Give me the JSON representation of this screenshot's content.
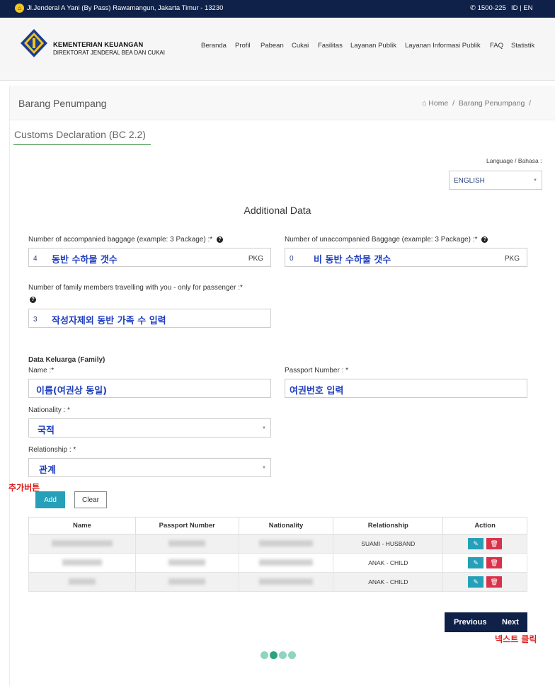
{
  "topbar": {
    "address": "Jl.Jenderal A Yani (By Pass) Rawamangun, Jakarta Timur - 13230",
    "phone": "1500-225",
    "lang": "ID | EN"
  },
  "brand": {
    "line1": "KEMENTERIAN KEUANGAN",
    "line2": "DIREKTORAT JENDERAL BEA DAN CUKAI"
  },
  "nav": [
    "Beranda",
    "Profil",
    "Pabean",
    "Cukai",
    "Fasilitas",
    "Layanan Publik",
    "Layanan Informasi Publik",
    "FAQ",
    "Statistik"
  ],
  "page": {
    "title": "Barang Penumpang",
    "breadcrumb_home": "Home",
    "breadcrumb_current": "Barang Penumpang"
  },
  "section_title": "Customs Declaration (BC 2.2)",
  "language": {
    "label": "Language / Bahasa :",
    "selected": "ENGLISH"
  },
  "subhead": "Additional Data",
  "baggage": {
    "accompanied_label": "Number of accompanied baggage (example: 3 Package) :*",
    "accompanied_value": "4",
    "accompanied_note": "동반 수하물 갯수",
    "unaccompanied_label": "Number of unaccompanied Baggage (example: 3 Package) :*",
    "unaccompanied_value": "0",
    "unaccompanied_note": "비 동반 수하물 갯수",
    "unit": "PKG",
    "family_count_label": "Number of family members travelling with you - only for passenger :*",
    "family_count_value": "3",
    "family_count_note": "작성자제외 동반 가족 수 입력"
  },
  "family_form": {
    "heading": "Data Keluarga (Family)",
    "name_label": "Name :*",
    "name_note": "이름(여권상 동일)",
    "passport_label": "Passport Number : *",
    "passport_note": "여권번호 입력",
    "nationality_label": "Nationality : *",
    "nationality_note": "국적",
    "relationship_label": "Relationship : *",
    "relationship_note": "관계",
    "add_note": "추가버튼",
    "add_label": "Add",
    "clear_label": "Clear"
  },
  "family_table": {
    "headers": [
      "Name",
      "Passport Number",
      "Nationality",
      "Relationship",
      "Action"
    ],
    "relationships": [
      "SUAMI - HUSBAND",
      "ANAK - CHILD",
      "ANAK - CHILD"
    ]
  },
  "pager": {
    "previous": "Previous",
    "next": "Next",
    "next_note": "넥스트 클릭"
  },
  "progress": {
    "steps": 4,
    "current": 2
  },
  "colors": {
    "navy": "#0f2148",
    "teal_button": "#26a0b8",
    "delete_red": "#d9334b",
    "annotation_blue": "#1f3fbf",
    "annotation_red": "#e01b1b"
  }
}
